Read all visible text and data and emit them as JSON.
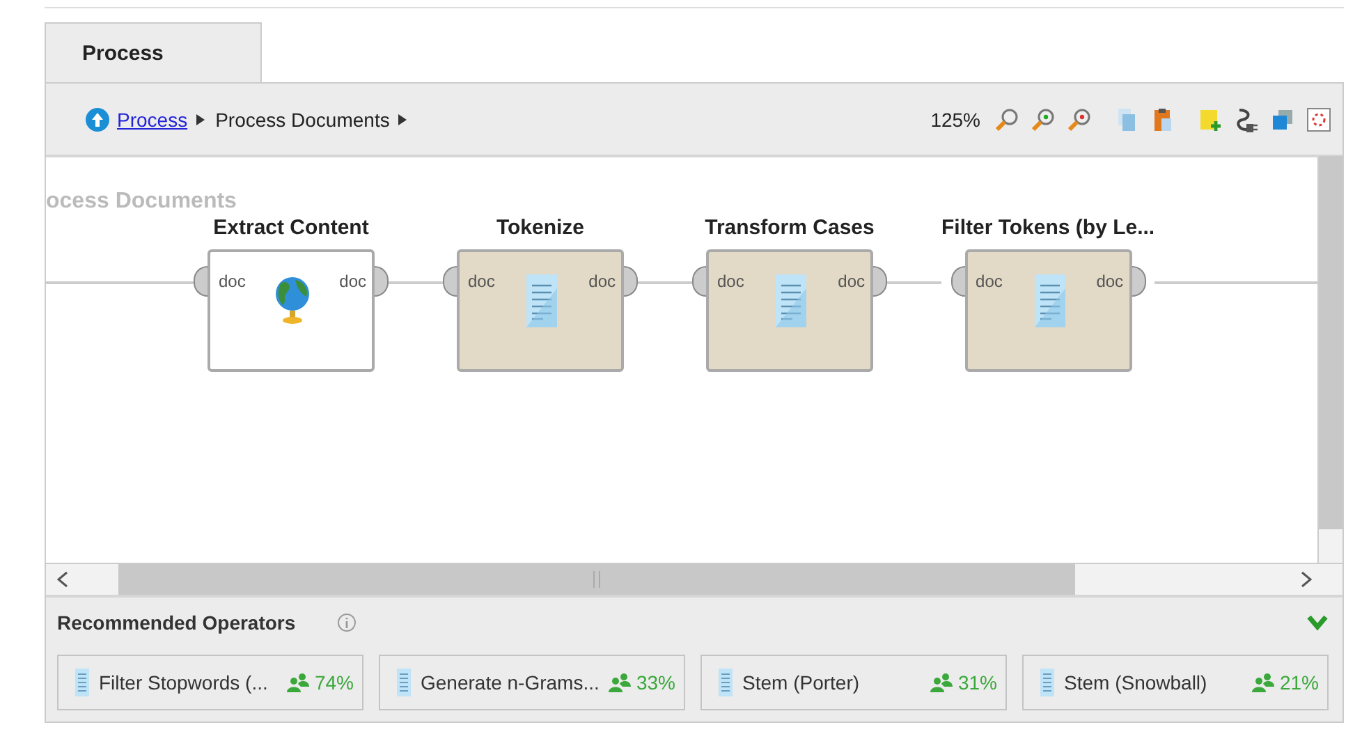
{
  "tab": {
    "label": "Process",
    "selected": true
  },
  "breadcrumb": [
    {
      "label": "Process",
      "kind": "link"
    },
    {
      "label": "Process Documents",
      "kind": "current"
    }
  ],
  "zoom": "125%",
  "canvas": {
    "title": "ocess Documents",
    "operators": [
      {
        "name": "Extract Content",
        "kind": "web",
        "input": "doc",
        "output": "doc"
      },
      {
        "name": "Tokenize",
        "kind": "text",
        "input": "doc",
        "output": "doc"
      },
      {
        "name": "Transform Cases",
        "kind": "text",
        "input": "doc",
        "output": "doc"
      },
      {
        "name": "Filter Tokens (by Le...",
        "kind": "text",
        "input": "doc",
        "output": "doc"
      }
    ]
  },
  "recommended": {
    "title": "Recommended Operators",
    "expanded": true,
    "items": [
      {
        "name": "Filter Stopwords (...",
        "share": "74%"
      },
      {
        "name": "Generate n-Grams...",
        "share": "33%"
      },
      {
        "name": "Stem (Porter)",
        "share": "31%"
      },
      {
        "name": "Stem (Snowball)",
        "share": "21%"
      }
    ]
  }
}
